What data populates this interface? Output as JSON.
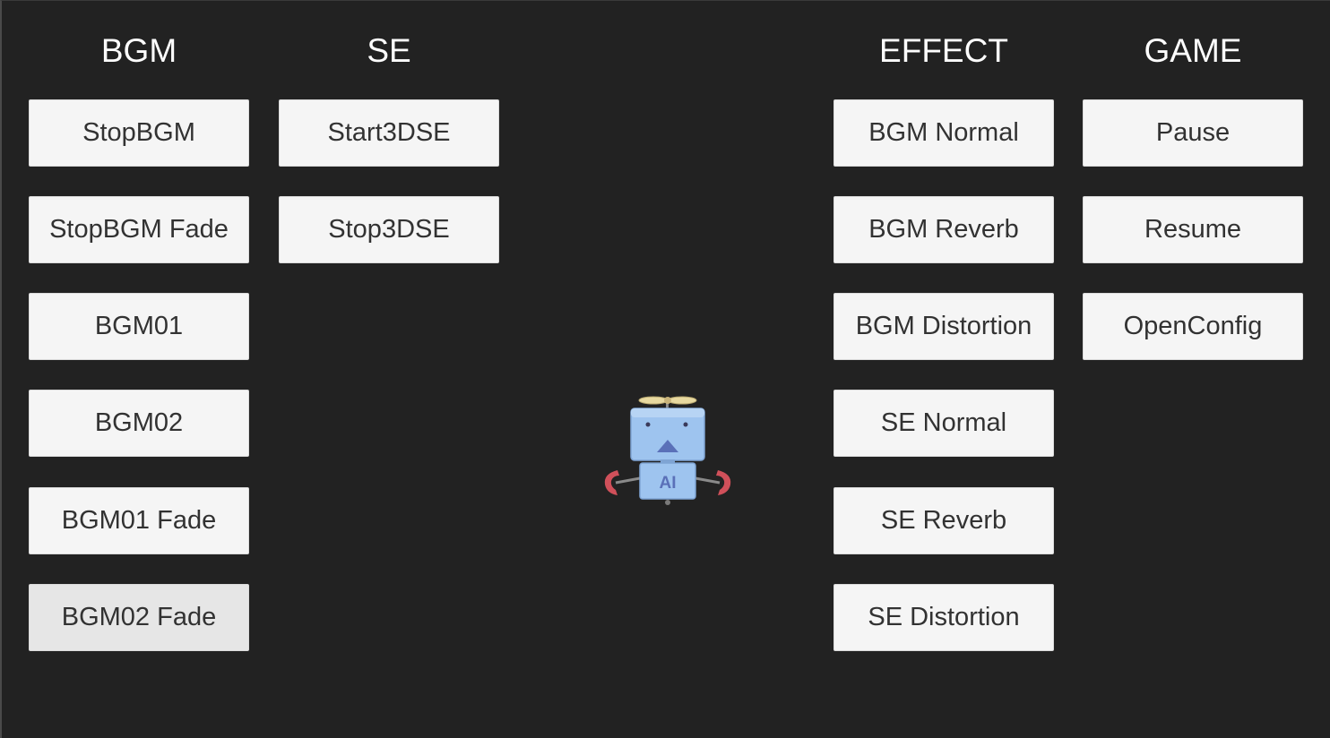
{
  "columns": {
    "bgm": {
      "title": "BGM",
      "buttons": [
        "StopBGM",
        "StopBGM Fade",
        "BGM01",
        "BGM02",
        "BGM01 Fade",
        "BGM02 Fade"
      ]
    },
    "se": {
      "title": "SE",
      "buttons": [
        "Start3DSE",
        "Stop3DSE"
      ]
    },
    "effect": {
      "title": "EFFECT",
      "buttons": [
        "BGM Normal",
        "BGM Reverb",
        "BGM Distortion",
        "SE Normal",
        "SE Reverb",
        "SE Distortion"
      ]
    },
    "game": {
      "title": "GAME",
      "buttons": [
        "Pause",
        "Resume",
        "OpenConfig"
      ]
    }
  },
  "mascot": {
    "icon": "robot-mascot-icon",
    "chest_label": "AI"
  },
  "colors": {
    "background": "#222222",
    "button": "#f5f5f5",
    "button_pressed": "#e6e6e6",
    "button_text": "#323232",
    "header_text": "#ffffff",
    "robot_body": "#9ec4ef",
    "robot_claws": "#d0505a"
  }
}
